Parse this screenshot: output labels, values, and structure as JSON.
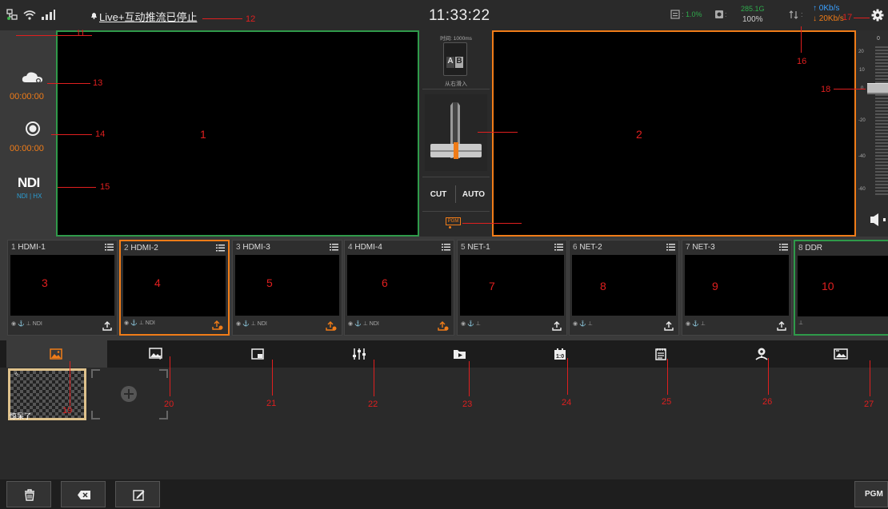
{
  "status": {
    "live_text": "Live+互动推流已停止",
    "clock": "11:33:22",
    "cpu": "1.0%",
    "disk_used": "285.1G",
    "disk_pct": "100%",
    "up_rate": "0Kb/s",
    "down_rate": "20Kb/s"
  },
  "left_panel": {
    "cloud_timer": "00:00:00",
    "record_timer": "00:00:00",
    "ndi_logo": "NDI",
    "ndi_mode": "NDI | HX"
  },
  "transition": {
    "time_label": "时间: 1000ms",
    "a_label": "A",
    "b_label": "B",
    "effect_label": "从右滑入",
    "cut_label": "CUT",
    "auto_label": "AUTO",
    "pgm_tag": "PGM"
  },
  "audio": {
    "scale": [
      "0",
      "20",
      "10",
      "0",
      "-20",
      "-40",
      "-60"
    ]
  },
  "sources": [
    {
      "index": "1",
      "name": "HDMI-1",
      "footer": "NDI"
    },
    {
      "index": "2",
      "name": "HDMI-2",
      "footer": "NDI"
    },
    {
      "index": "3",
      "name": "HDMI-3",
      "footer": "NDI"
    },
    {
      "index": "4",
      "name": "HDMI-4",
      "footer": "NDI"
    },
    {
      "index": "5",
      "name": "NET-1",
      "footer": ""
    },
    {
      "index": "6",
      "name": "NET-2",
      "footer": ""
    },
    {
      "index": "7",
      "name": "NET-3",
      "footer": ""
    },
    {
      "index": "8",
      "name": "DDR",
      "footer": ""
    }
  ],
  "media": {
    "item_label": "惊呆了"
  },
  "bottom": {
    "pgm_label": "PGM"
  },
  "annotations": [
    "1",
    "2",
    "3",
    "4",
    "5",
    "6",
    "7",
    "8",
    "9",
    "10",
    "11",
    "12",
    "13",
    "14",
    "15",
    "16",
    "17",
    "18",
    "19",
    "20",
    "21",
    "22",
    "23",
    "24",
    "25",
    "26",
    "27"
  ],
  "colors": {
    "accent_orange": "#f07c18",
    "preview_green": "#2f9a4a",
    "annotation_red": "#e01f1f",
    "up_blue": "#3aa0ff"
  }
}
